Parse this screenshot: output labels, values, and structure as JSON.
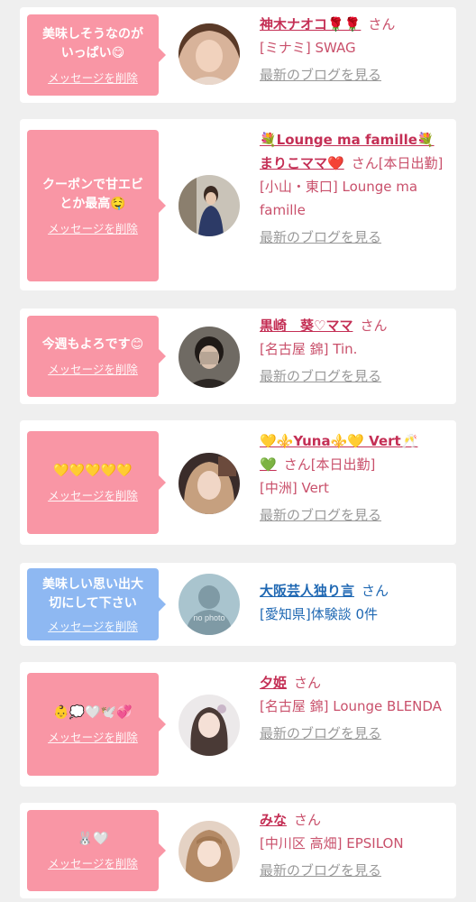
{
  "common": {
    "delete_label": "メッセージを削除",
    "blog_label": "最新のブログを見る",
    "honorific": "さん"
  },
  "items": [
    {
      "message_l1": "美味しそうなのが",
      "message_l2": "いっぱい😋",
      "name": "神木ナオコ🌹🌹",
      "sub": "[ミナミ] SWAG"
    },
    {
      "message_l1": "クーポンで甘エビ",
      "message_l2": "とか最高🤤",
      "name_l1": "💐Lounge ma famille💐",
      "name_l2": "まりこママ❤️",
      "status": "[本日出勤]",
      "sub": "[小山・東口] Lounge ma famille"
    },
    {
      "message_l1": "今週もよろです😊",
      "name": "黒崎　葵♡ママ",
      "sub": "[名古屋 錦] Tin."
    },
    {
      "message_l1": "💛💛💛💛💛",
      "name_l1": "💛⚜️Yuna⚜️💛 Vert🥂",
      "name_l2": "💚",
      "status": "[本日出勤]",
      "sub": "[中洲] Vert"
    },
    {
      "message_l1": "美味しい思い出大",
      "message_l2": "切にして下さい",
      "name": "大阪芸人独り言",
      "sub": "[愛知県]体験談 0件",
      "avatar_text": "no photo"
    },
    {
      "message_l1": "👶💭🤍🕊️💞",
      "name": "夕姫",
      "sub": "[名古屋 錦] Lounge BLENDA"
    },
    {
      "message_l1": "🐰🤍",
      "name": "みな",
      "sub": "[中川区 高畑] EPSILON"
    }
  ]
}
